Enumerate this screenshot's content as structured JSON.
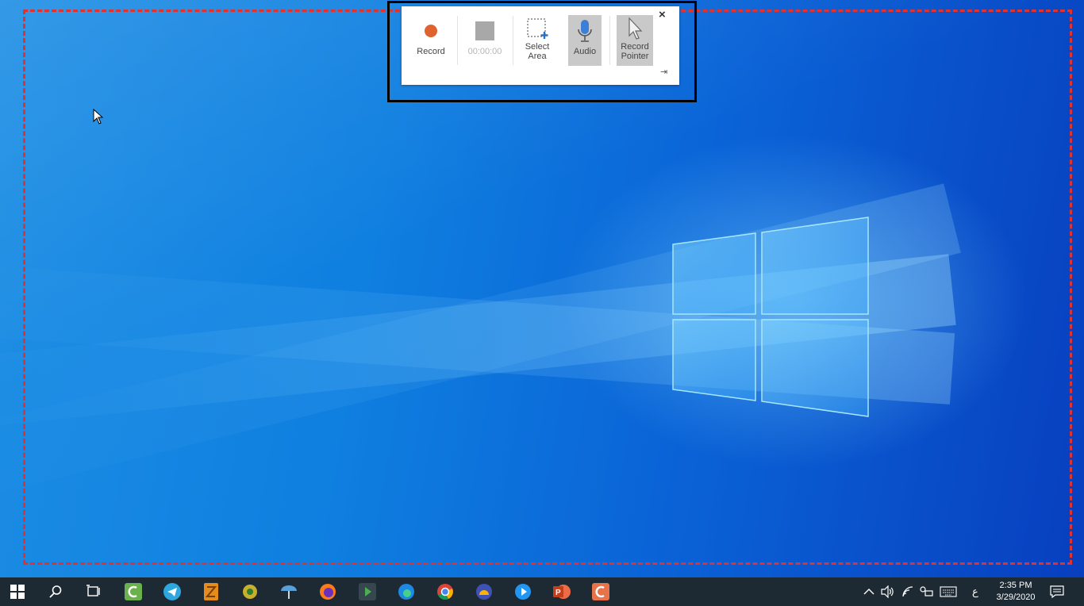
{
  "dock": {
    "record_label": "Record",
    "timer": "00:00:00",
    "select_area_label": "Select\nArea",
    "audio_label": "Audio",
    "record_pointer_label": "Record\nPointer",
    "close_symbol": "×",
    "pin_symbol": "⇥"
  },
  "taskbar": {
    "apps": [
      "start-icon",
      "search-icon",
      "task-view-icon",
      "camtasia-icon",
      "telegram-icon",
      "app-icon",
      "app-icon",
      "app-icon",
      "firefox-icon",
      "app-icon",
      "edge-icon",
      "chrome-icon",
      "app-icon",
      "app-icon",
      "powerpoint-icon",
      "app-icon"
    ],
    "language": "ع",
    "time": "2:35 PM",
    "date": "3/29/2020"
  },
  "colors": {
    "record_red": "#e0622e",
    "selection_border": "#e2322f",
    "taskbar_bg": "#1e2a33"
  }
}
